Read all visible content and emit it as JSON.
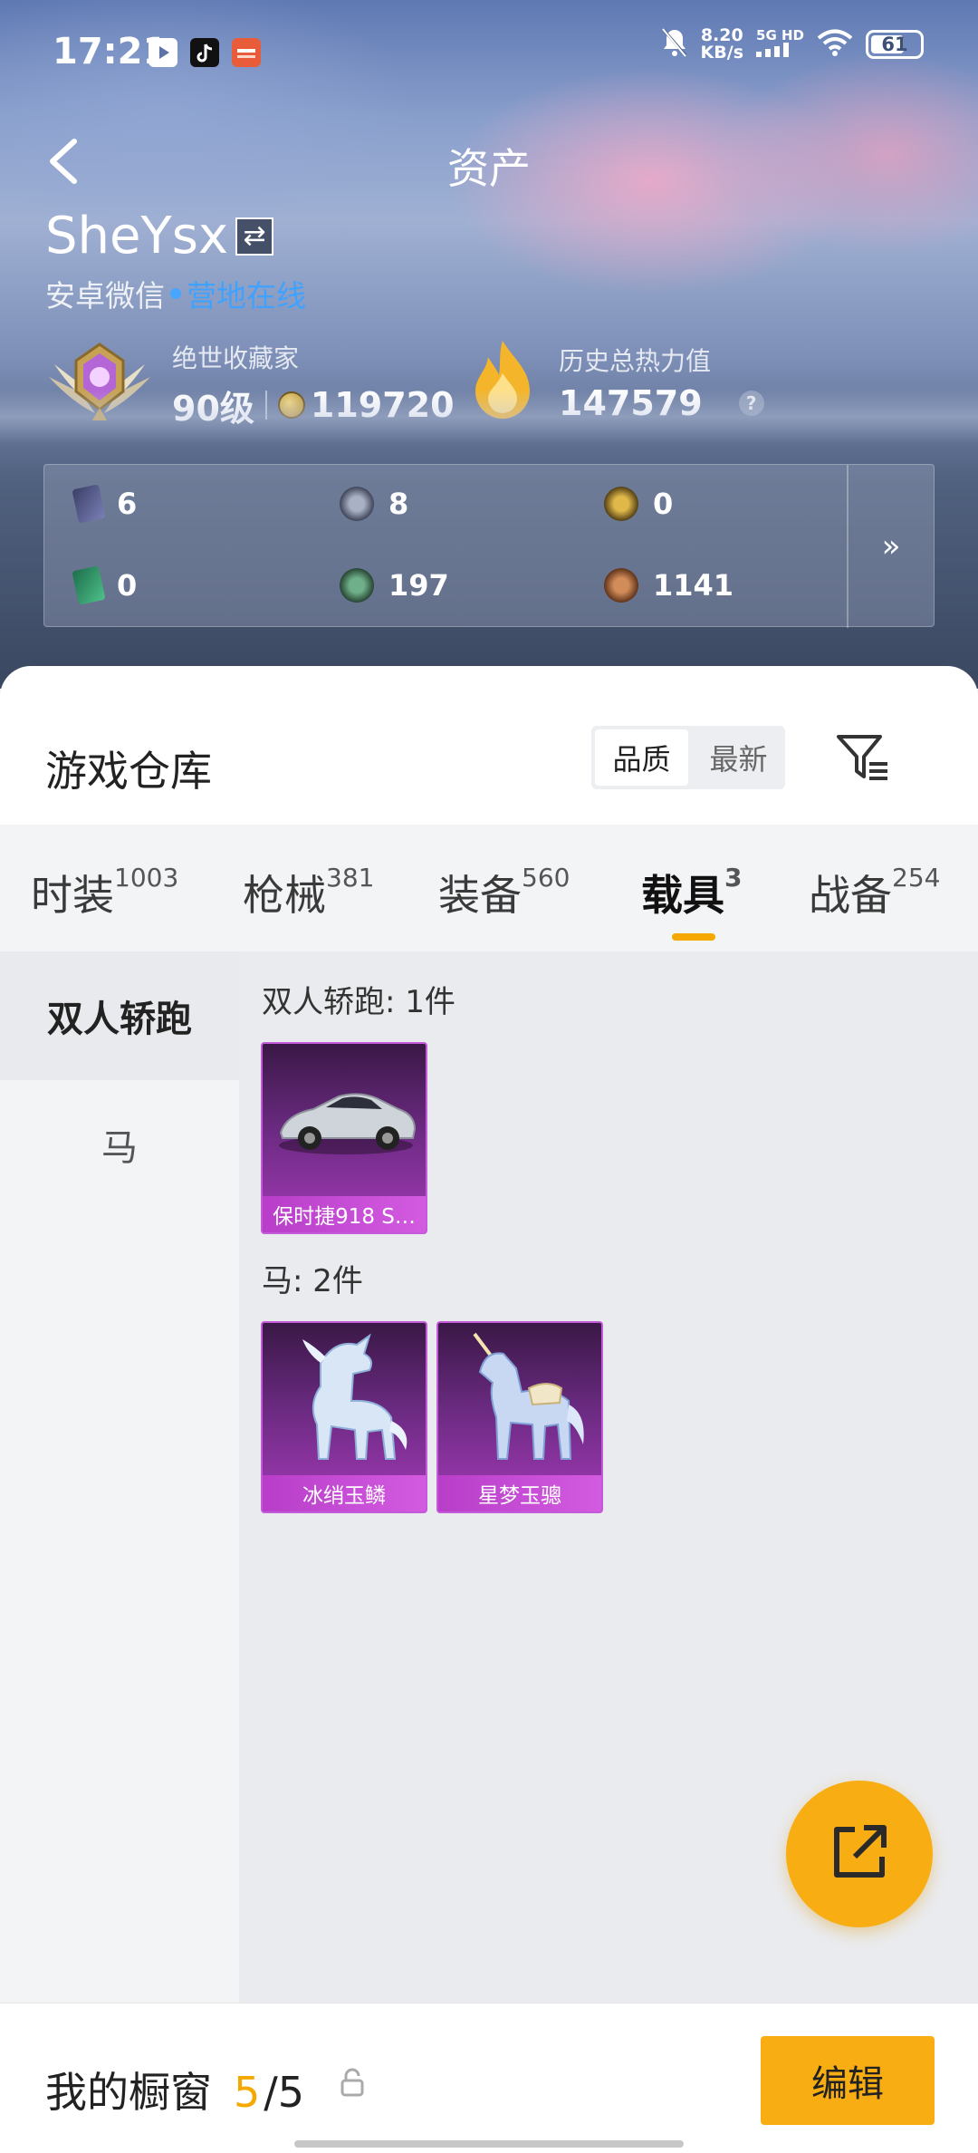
{
  "status_bar": {
    "time": "17:21",
    "net_speed_value": "8.20",
    "net_speed_unit": "KB/s",
    "network_label": "5G HD",
    "battery": "61"
  },
  "nav": {
    "title": "资产"
  },
  "profile": {
    "username": "SheYsx",
    "login_platform": "安卓微信",
    "online_status": "营地在线",
    "collector": {
      "label": "绝世收藏家",
      "level": "90级",
      "points": "119720"
    },
    "heat": {
      "label": "历史总热力值",
      "value": "147579",
      "help": "?"
    }
  },
  "currencies": [
    {
      "icon": "card-currency-icon",
      "value": "6"
    },
    {
      "icon": "silver-coin-icon",
      "value": "8"
    },
    {
      "icon": "gold-badge-icon",
      "value": "0"
    },
    {
      "icon": "green-ticket-icon",
      "value": "0"
    },
    {
      "icon": "green-coin-icon",
      "value": "197"
    },
    {
      "icon": "bronze-coin-icon",
      "value": "1141"
    }
  ],
  "currency_more": "»",
  "warehouse": {
    "title": "游戏仓库",
    "sort_options": [
      "品质",
      "最新"
    ],
    "sort_selected": "品质"
  },
  "tabs": [
    {
      "label": "时装",
      "count": "1003"
    },
    {
      "label": "枪械",
      "count": "381"
    },
    {
      "label": "装备",
      "count": "560"
    },
    {
      "label": "载具",
      "count": "3",
      "active": true
    },
    {
      "label": "战备",
      "count": "254"
    }
  ],
  "categories": [
    {
      "label": "双人轿跑",
      "active": true
    },
    {
      "label": "马"
    }
  ],
  "groups": [
    {
      "title": "双人轿跑: 1件",
      "items": [
        {
          "name": "保时捷918 S…"
        }
      ]
    },
    {
      "title": "马: 2件",
      "items": [
        {
          "name": "冰绡玉鳞"
        },
        {
          "name": "星梦玉骢"
        }
      ]
    }
  ],
  "showcase": {
    "label": "我的橱窗",
    "current": "5",
    "total": "/5"
  },
  "edit_button": "编辑",
  "colors": {
    "accent": "#f8ad12",
    "online": "#3fa2ff",
    "card_purple": "#a43ab8"
  }
}
